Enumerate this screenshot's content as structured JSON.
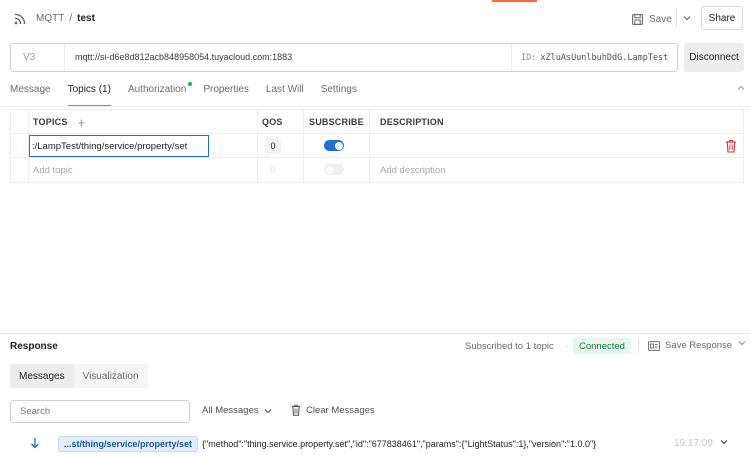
{
  "header": {
    "protocol": "MQTT",
    "separator": "/",
    "request_name": "test",
    "save_label": "Save",
    "share_label": "Share"
  },
  "connection": {
    "version": "V3",
    "url": "mqtt://si-d6e8d812acb848958054.tuyacloud.com:1883",
    "client_id_label": "ID:",
    "client_id": "xZluAsUunlbuhDdG.LampTest",
    "disconnect_label": "Disconnect"
  },
  "tabs": [
    {
      "label": "Message"
    },
    {
      "label": "Topics (1)"
    },
    {
      "label": "Authorization"
    },
    {
      "label": "Properties"
    },
    {
      "label": "Last Will"
    },
    {
      "label": "Settings"
    }
  ],
  "topics_table": {
    "headers": {
      "topics": "TOPICS",
      "qos": "QOS",
      "subscribe": "SUBSCRIBE",
      "description": "DESCRIPTION"
    },
    "rows": [
      {
        "topic": ":/LampTest/thing/service/property/set",
        "qos": "0",
        "subscribed": true,
        "description": ""
      }
    ],
    "add_row": {
      "topic_placeholder": "Add topic",
      "qos_placeholder": "0",
      "description_placeholder": "Add description"
    }
  },
  "response": {
    "title": "Response",
    "subscribed_count": "Subscribed to 1 topic",
    "status": "Connected",
    "save_response_label": "Save Response",
    "tabs": [
      {
        "label": "Messages"
      },
      {
        "label": "Visualization"
      }
    ],
    "search_placeholder": "Search",
    "filter_label": "All Messages",
    "clear_label": "Clear Messages",
    "messages": [
      {
        "direction": "incoming",
        "topic": "...st/thing/service/property/set",
        "payload": "{\"method\":\"thing.service.property.set\",\"id\":\"677838461\",\"params\":{\"LightStatus\":1},\"version\":\"1.0.0\"}",
        "time": "19:17:09"
      }
    ]
  },
  "colors": {
    "accent": "#ff6c37",
    "primary_blue": "#1f6fd8",
    "connected_green": "#0a7d3a",
    "trash_red": "#d93025"
  }
}
